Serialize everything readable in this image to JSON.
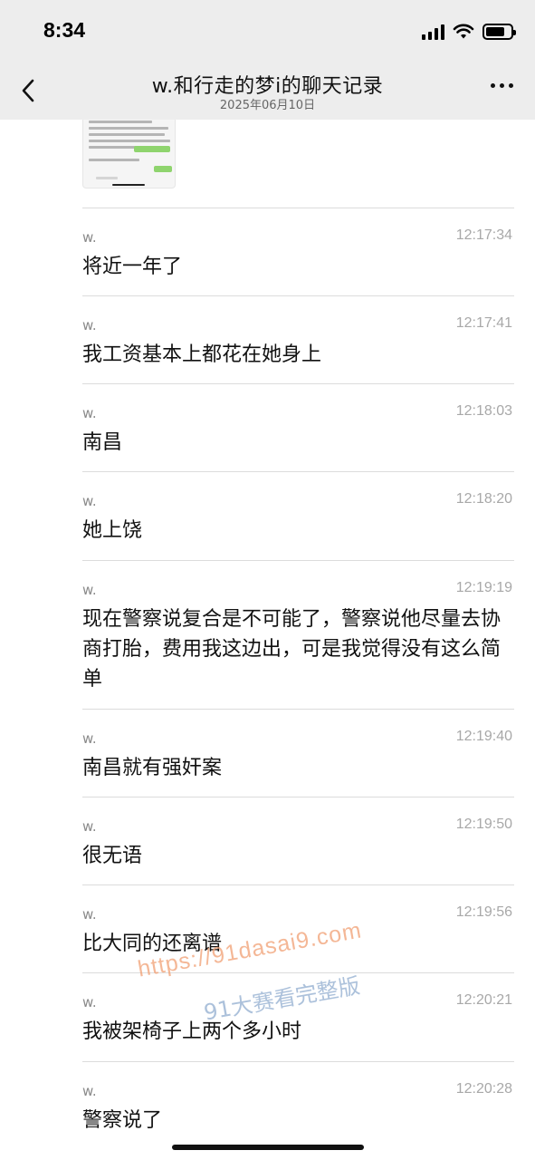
{
  "status_bar": {
    "time": "8:34"
  },
  "header": {
    "title": "w.和行走的梦i的聊天记录",
    "date": "2025年06月10日"
  },
  "messages": [
    {
      "sender": "w.",
      "time": "12:17:34",
      "text": "将近一年了"
    },
    {
      "sender": "w.",
      "time": "12:17:41",
      "text": "我工资基本上都花在她身上"
    },
    {
      "sender": "w.",
      "time": "12:18:03",
      "text": "南昌"
    },
    {
      "sender": "w.",
      "time": "12:18:20",
      "text": "她上饶"
    },
    {
      "sender": "w.",
      "time": "12:19:19",
      "text": "现在警察说复合是不可能了，警察说他尽量去协商打胎，费用我这边出，可是我觉得没有这么简单"
    },
    {
      "sender": "w.",
      "time": "12:19:40",
      "text": "南昌就有强奸案"
    },
    {
      "sender": "w.",
      "time": "12:19:50",
      "text": "很无语"
    },
    {
      "sender": "w.",
      "time": "12:19:56",
      "text": "比大同的还离谱"
    },
    {
      "sender": "w.",
      "time": "12:20:21",
      "text": "我被架椅子上两个多小时"
    },
    {
      "sender": "w.",
      "time": "12:20:28",
      "text": "警察说了"
    }
  ],
  "watermark": {
    "url": "https://91dasai9.com",
    "text": "91大赛看完整版"
  }
}
